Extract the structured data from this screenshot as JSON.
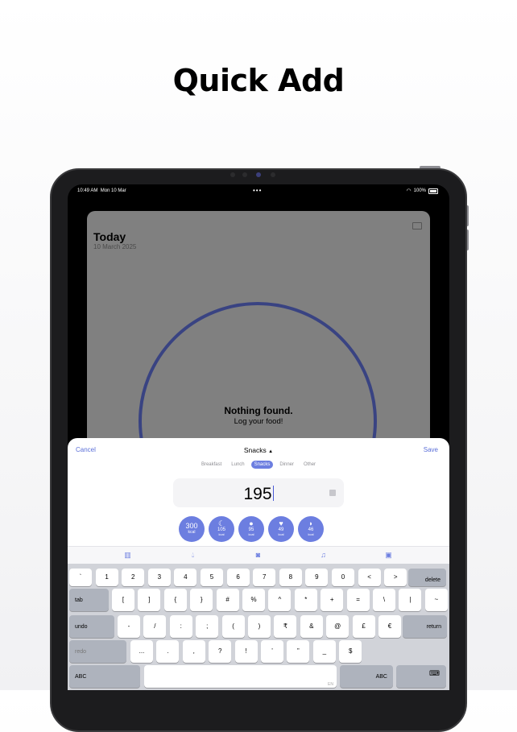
{
  "headline": "Quick Add",
  "status_bar": {
    "time": "10:49 AM",
    "date": "Mon 10 Mar",
    "battery": "100%",
    "dots": "•••"
  },
  "today": {
    "title": "Today",
    "date": "10 March 2025"
  },
  "empty_state": {
    "title": "Nothing found.",
    "subtitle": "Log your food!"
  },
  "sheet": {
    "cancel_label": "Cancel",
    "meal_label": "Snacks",
    "meal_caret": "▲",
    "save_label": "Save",
    "meal_tabs": [
      "Breakfast",
      "Lunch",
      "Snacks",
      "Dinner",
      "Other"
    ],
    "selected_tab": "Snacks",
    "calorie_value": "195"
  },
  "quick_adds": [
    {
      "kcal": "300",
      "unit": "kcal",
      "icon": "number"
    },
    {
      "kcal": "105",
      "unit": "kcal",
      "icon": "banana-icon"
    },
    {
      "kcal": "95",
      "unit": "kcal",
      "icon": "apple-icon"
    },
    {
      "kcal": "49",
      "unit": "kcal",
      "icon": "strawberry-icon"
    },
    {
      "kcal": "46",
      "unit": "kcal",
      "icon": "melon-icon"
    }
  ],
  "accessory_icons": [
    "barcode-icon",
    "water-drop-icon",
    "camera-icon",
    "microphone-icon",
    "game-icon"
  ],
  "keyboard": {
    "row1": [
      "`",
      "1",
      "2",
      "3",
      "4",
      "5",
      "6",
      "7",
      "8",
      "9",
      "0",
      "<",
      ">"
    ],
    "delete": "delete",
    "tab": "tab",
    "row2": [
      "[",
      "]",
      "{",
      "}",
      "#",
      "%",
      "^",
      "*",
      "+",
      "=",
      "\\",
      "|",
      "~"
    ],
    "undo": "undo",
    "row3": [
      "-",
      "/",
      ":",
      ";",
      "(",
      ")",
      "₹",
      "&",
      "@",
      "£",
      "€"
    ],
    "return": "return",
    "redo": "redo",
    "row4": [
      "...",
      ".",
      ",",
      "?",
      "!",
      "’",
      "”",
      "_",
      "$"
    ],
    "abc_left": "ABC",
    "abc_right": "ABC",
    "space_hint": "EN"
  }
}
